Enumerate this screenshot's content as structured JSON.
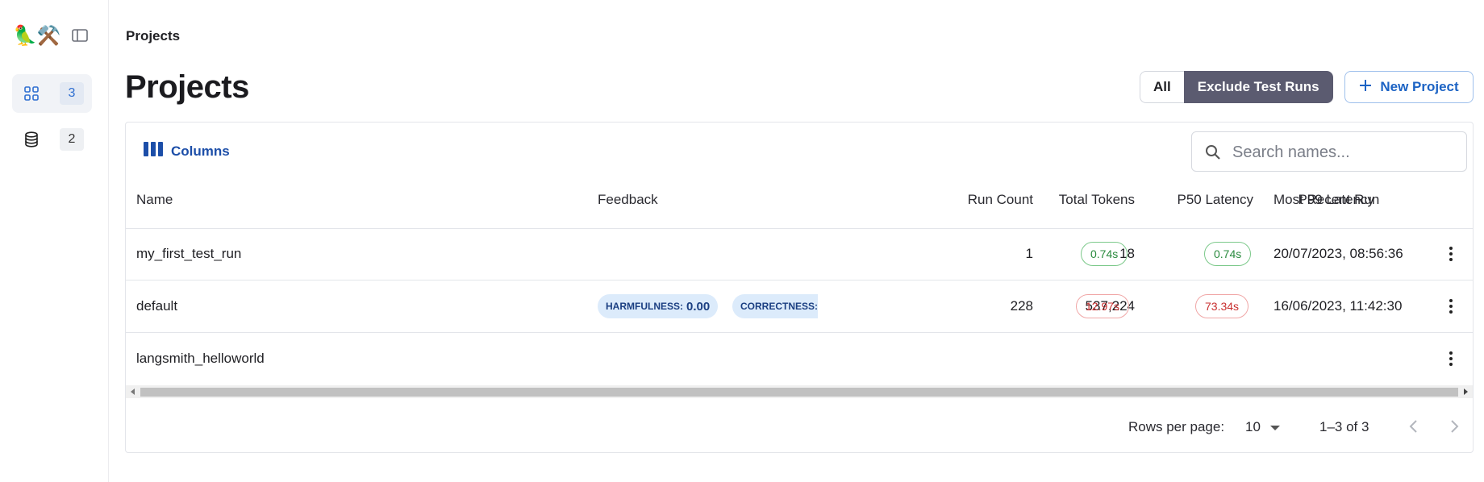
{
  "app": {
    "logo": "🦜⚒️"
  },
  "sidebar": {
    "items": [
      {
        "icon": "grid-icon",
        "count": "3",
        "active": true
      },
      {
        "icon": "database-icon",
        "count": "2",
        "active": false
      }
    ]
  },
  "breadcrumb": "Projects",
  "page_title": "Projects",
  "filter": {
    "all_label": "All",
    "exclude_label": "Exclude Test Runs",
    "selected": "Exclude Test Runs"
  },
  "new_project_label": "New Project",
  "toolbar": {
    "columns_label": "Columns",
    "search_placeholder": "Search names..."
  },
  "table": {
    "headers": {
      "name": "Name",
      "feedback": "Feedback",
      "run_count": "Run Count",
      "total_tokens": "Total Tokens",
      "p50": "P50 Latency",
      "p99": "P99 Latency",
      "recent": "Most Recent Run"
    },
    "rows": [
      {
        "name": "my_first_test_run",
        "feedback": [],
        "run_count": "1",
        "total_tokens": "18",
        "p50": "0.74s",
        "p50_status": "good",
        "p99": "0.74s",
        "p99_status": "good",
        "recent": "20/07/2023, 08:56:36"
      },
      {
        "name": "default",
        "feedback": [
          {
            "key": "HARMFULNESS:",
            "value": "0.00"
          },
          {
            "key": "CORRECTNESS:",
            "value": ""
          }
        ],
        "run_count": "228",
        "total_tokens": "537,224",
        "p50": "12.97s",
        "p50_status": "bad",
        "p99": "73.34s",
        "p99_status": "bad",
        "recent": "16/06/2023, 11:42:30"
      },
      {
        "name": "langsmith_helloworld",
        "feedback": [],
        "run_count": "",
        "total_tokens": "",
        "p50": "",
        "p99": "",
        "recent": ""
      }
    ]
  },
  "pagination": {
    "rows_per_page_label": "Rows per page:",
    "rows_per_page": "10",
    "range": "1–3 of 3"
  },
  "colors": {
    "accent": "#1c63c4",
    "selected_filter_bg": "#5b5b70",
    "good": "#2a8a3e",
    "bad": "#c93030"
  }
}
